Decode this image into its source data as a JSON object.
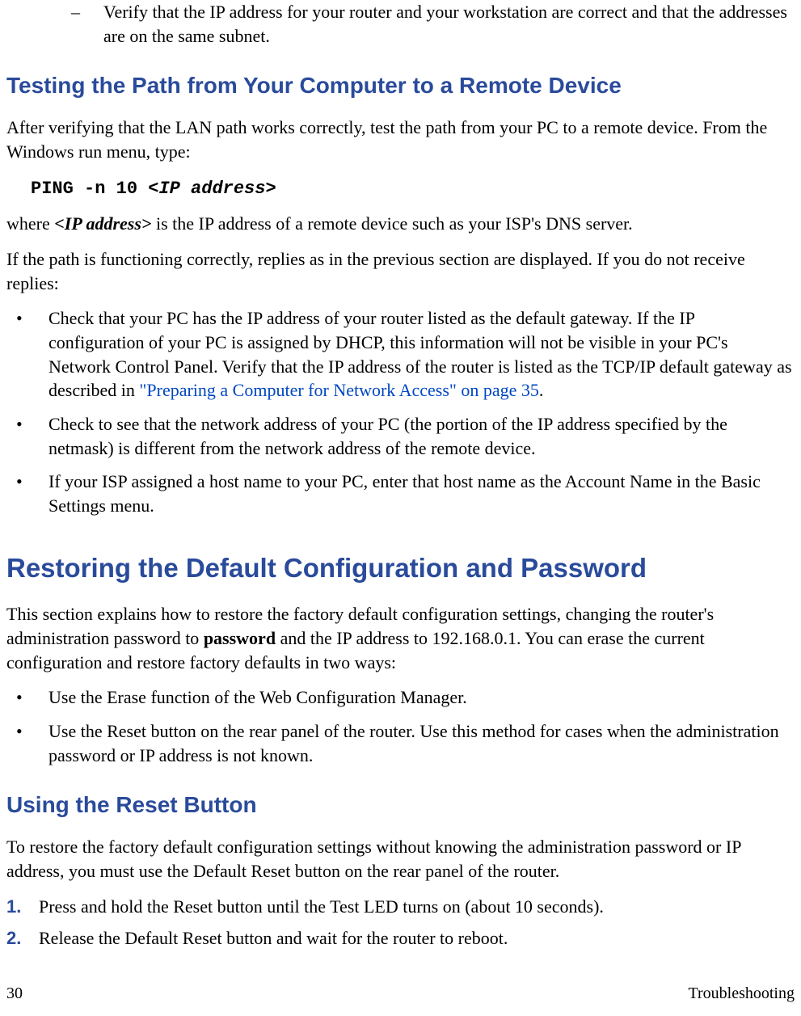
{
  "top_dash": {
    "marker": "–",
    "text": "Verify that the IP address for your router and your workstation are correct and that the addresses are on the same subnet."
  },
  "sec1": {
    "heading": "Testing the Path from Your Computer to a Remote Device",
    "p1": "After verifying that the LAN path works correctly, test the path from your PC to a remote device. From the Windows run menu, type:",
    "cmd_prefix": "PING -n 10 <",
    "cmd_var": "IP address",
    "cmd_suffix": ">",
    "p2a": "where ",
    "p2b": "<IP address>",
    "p2c": " is the IP address of a remote device such as your ISP's DNS server.",
    "p3": "If the path is functioning correctly, replies as in the previous section are displayed. If you do not receive replies:",
    "bul1a": "Check that your PC has the IP address of your router listed as the default gateway. If the IP configuration of your PC is assigned by DHCP, this information will not be visible in your PC's Network Control Panel. Verify that the IP address of the router is listed as the TCP/IP default gateway as described in ",
    "bul1link": "\"Preparing a Computer for Network Access\" on page 35",
    "bul1b": ".",
    "bul2": "Check to see that the network address of your PC (the portion of the IP address specified by the netmask) is different from the network address of the remote device.",
    "bul3": "If your ISP assigned a host name to your PC, enter that host name as the Account Name in the Basic Settings menu."
  },
  "sec2": {
    "heading": "Restoring the Default Configuration and Password",
    "p1a": "This section explains how to restore the factory default configuration settings, changing the router's administration password to ",
    "p1b": "password",
    "p1c": " and the IP address to 192.168.0.1. You can erase the current configuration and restore factory defaults in two ways:",
    "bul1": "Use the Erase function of the Web Configuration Manager.",
    "bul2": "Use the Reset button on the rear panel of the router. Use this method for cases when the administration password or IP address is not known."
  },
  "sec3": {
    "heading": "Using the Reset Button",
    "p1": "To restore the factory default configuration settings without knowing the administration password or IP address, you must use the Default Reset button on the rear panel of the router.",
    "step1num": "1.",
    "step1": "Press and hold the Reset button until the Test LED turns on (about 10 seconds).",
    "step2num": "2.",
    "step2": "Release the Default Reset button and wait for the router to reboot."
  },
  "footer": {
    "page": "30",
    "section": "Troubleshooting"
  },
  "bullet_char": "•"
}
